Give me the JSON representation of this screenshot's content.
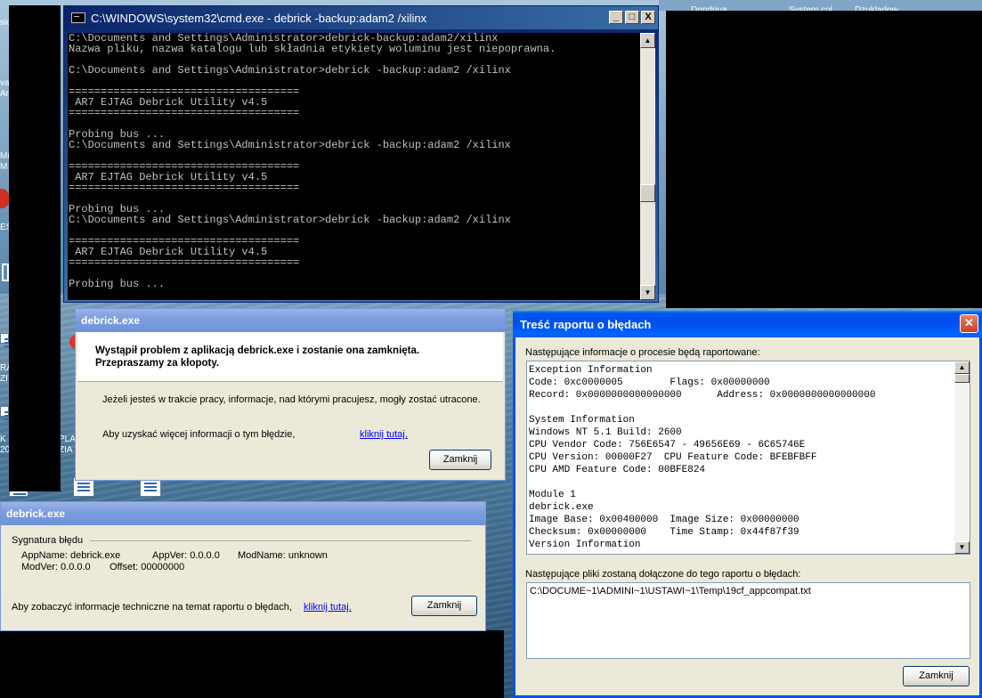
{
  "desktop": {
    "taskbar_fragments": [
      "Dondriua",
      "System col",
      "Dzukladow"
    ],
    "left_fragments": [
      "sic",
      "va",
      "Ar",
      "Mi",
      "M",
      "ES",
      "RA",
      "ZI",
      "C",
      "K",
      "20",
      "PLA",
      "ZIA"
    ]
  },
  "cmd": {
    "title": "C:\\WINDOWS\\system32\\cmd.exe - debrick -backup:adam2 /xilinx",
    "minimize": "_",
    "maximize": "□",
    "close": "X",
    "lines": [
      "C:\\Documents and Settings\\Administrator>debrick-backup:adam2/xilinx",
      "Nazwa pliku, nazwa katalogu lub składnia etykiety woluminu jest niepoprawna.",
      "",
      "C:\\Documents and Settings\\Administrator>debrick -backup:adam2 /xilinx",
      "",
      "====================================",
      " AR7 EJTAG Debrick Utility v4.5",
      "====================================",
      "",
      "Probing bus ...",
      "C:\\Documents and Settings\\Administrator>debrick -backup:adam2 /xilinx",
      "",
      "====================================",
      " AR7 EJTAG Debrick Utility v4.5",
      "====================================",
      "",
      "Probing bus ...",
      "C:\\Documents and Settings\\Administrator>debrick -backup:adam2 /xilinx",
      "",
      "====================================",
      " AR7 EJTAG Debrick Utility v4.5",
      "====================================",
      "",
      "Probing bus ..."
    ]
  },
  "crash_dialog": {
    "title": "debrick.exe",
    "headline": "Wystąpił problem z aplikacją debrick.exe i zostanie ona zamknięta. Przepraszamy za kłopoty.",
    "body": "Jeżeli jesteś w trakcie pracy, informacje, nad którymi pracujesz, mogły zostać utracone.",
    "more_info_text": "Aby uzyskać więcej informacji o tym błędzie,",
    "more_info_link": "kliknij tutaj.",
    "close_button": "Zamknij"
  },
  "signature_dialog": {
    "title": "debrick.exe",
    "group_label": "Sygnatura błędu",
    "app_name": "AppName: debrick.exe",
    "app_ver": "AppVer: 0.0.0.0",
    "mod_name": "ModName: unknown",
    "mod_ver": "ModVer: 0.0.0.0",
    "offset": "Offset: 00000000",
    "tech_info_text": "Aby zobaczyć informacje techniczne na temat raportu o błędach,",
    "tech_info_link": "kliknij tutaj.",
    "close_button": "Zamknij"
  },
  "report_window": {
    "title": "Treść raportu o błędach",
    "intro": "Następujące informacje o procesie będą raportowane:",
    "report_lines": [
      "Exception Information",
      "Code: 0xc0000005        Flags: 0x00000000",
      "Record: 0x0000000000000000      Address: 0x0000000000000000",
      "",
      "System Information",
      "Windows NT 5.1 Build: 2600",
      "CPU Vendor Code: 756E6547 - 49656E69 - 6C65746E",
      "CPU Version: 00000F27  CPU Feature Code: BFEBFBFF",
      "CPU AMD Feature Code: 00BFE824",
      "",
      "Module 1",
      "debrick.exe",
      "Image Base: 0x00400000  Image Size: 0x00000000",
      "Checksum: 0x00000000    Time Stamp: 0x44f87f39",
      "Version Information"
    ],
    "files_label": "Następujące pliki zostaną dołączone do tego raportu o błędach:",
    "file_path": "C:\\DOCUME~1\\ADMINI~1\\USTAWI~1\\Temp\\19cf_appcompat.txt",
    "close_button": "Zamknij",
    "close_icon": "close-icon"
  }
}
